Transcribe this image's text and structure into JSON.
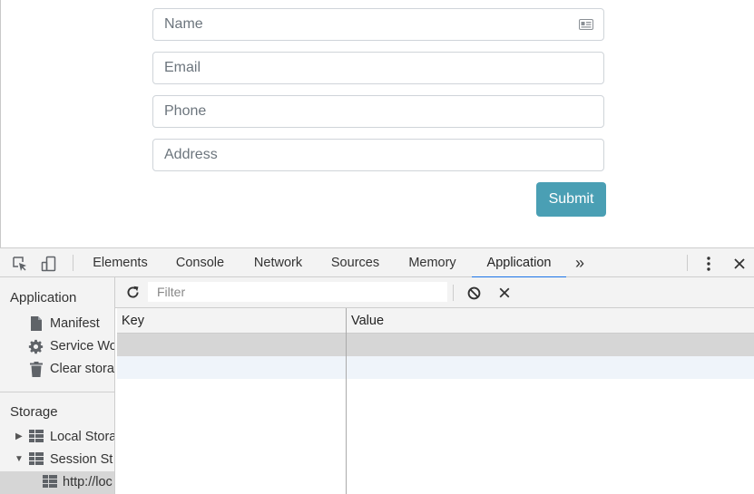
{
  "form": {
    "name_placeholder": "Name",
    "email_placeholder": "Email",
    "phone_placeholder": "Phone",
    "address_placeholder": "Address",
    "submit_label": "Submit",
    "submit_color": "#4a9fb4"
  },
  "devtools": {
    "tabs": [
      {
        "label": "Elements"
      },
      {
        "label": "Console"
      },
      {
        "label": "Network"
      },
      {
        "label": "Sources"
      },
      {
        "label": "Memory"
      },
      {
        "label": "Application",
        "active": true
      }
    ],
    "more_tabs_label": "»",
    "active_tab_color": "#1a73e8",
    "sidebar": {
      "application_title": "Application",
      "application_items": [
        {
          "label": "Manifest",
          "icon": "document-icon"
        },
        {
          "label": "Service Wo",
          "icon": "gear-icon"
        },
        {
          "label": "Clear stora",
          "icon": "trash-icon"
        }
      ],
      "storage_title": "Storage",
      "storage_items": [
        {
          "label": "Local Stora",
          "icon": "grid-icon",
          "expanded": false
        },
        {
          "label": "Session St",
          "icon": "grid-icon",
          "expanded": true
        },
        {
          "label": "http://loc",
          "icon": "grid-icon",
          "selected": true
        }
      ]
    },
    "toolbar": {
      "filter_placeholder": "Filter"
    },
    "table": {
      "columns": [
        "Key",
        "Value"
      ],
      "rows": [
        {
          "key": "",
          "value": "",
          "selected": true
        },
        {
          "key": "",
          "value": ""
        }
      ]
    }
  }
}
